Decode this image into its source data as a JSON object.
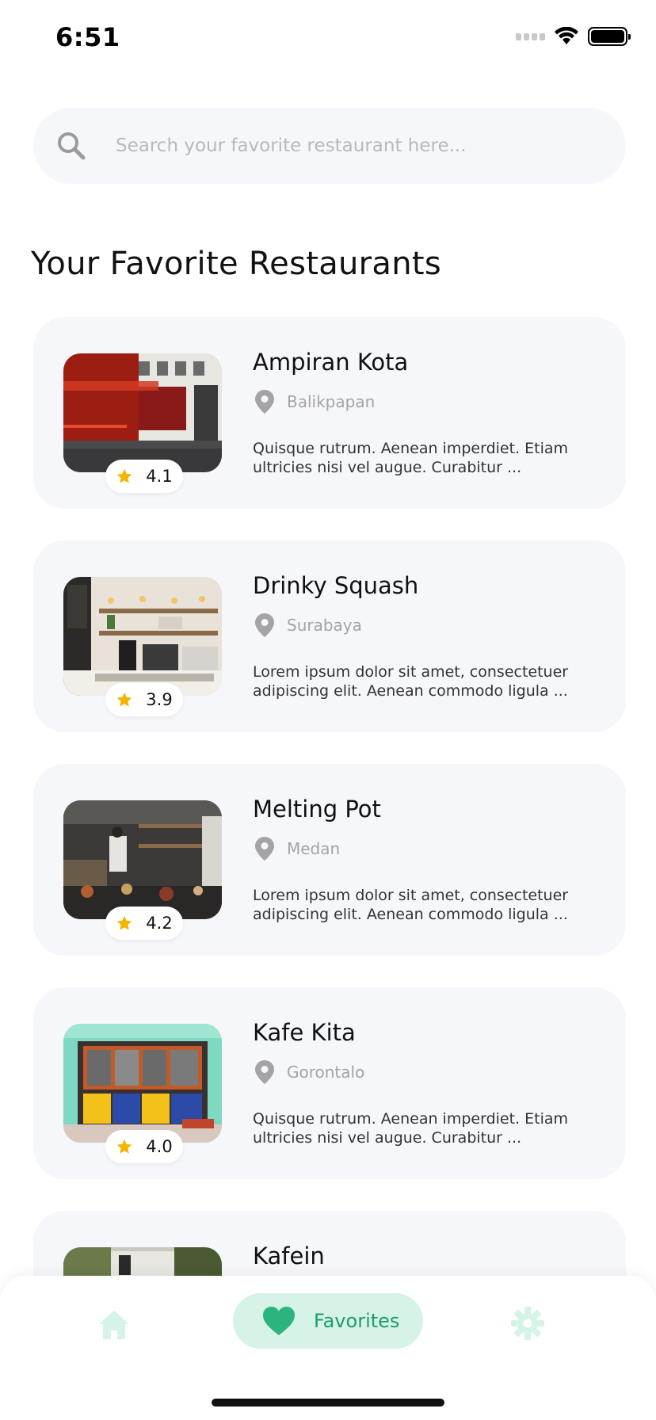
{
  "status_bar": {
    "time": "6:51"
  },
  "search": {
    "placeholder": "Search your favorite restaurant here..."
  },
  "page_title": "Your Favorite Restaurants",
  "colors": {
    "accent": "#2bb47d",
    "accent_soft": "#d5f3e6",
    "star": "#f5b400",
    "card_bg": "#f6f7fb"
  },
  "restaurants": [
    {
      "name": "Ampiran Kota",
      "city": "Balikpapan",
      "rating": "4.1",
      "description": "Quisque rutrum. Aenean imperdiet. Etiam ultricies nisi vel augue. Curabitur ..."
    },
    {
      "name": "Drinky Squash",
      "city": "Surabaya",
      "rating": "3.9",
      "description": "Lorem ipsum dolor sit amet, consectetuer adipiscing elit. Aenean commodo ligula ..."
    },
    {
      "name": "Melting Pot",
      "city": "Medan",
      "rating": "4.2",
      "description": "Lorem ipsum dolor sit amet, consectetuer adipiscing elit. Aenean commodo ligula ..."
    },
    {
      "name": "Kafe Kita",
      "city": "Gorontalo",
      "rating": "4.0",
      "description": "Quisque rutrum. Aenean imperdiet. Etiam ultricies nisi vel augue. Curabitur ..."
    },
    {
      "name": "Kafein",
      "city": "",
      "rating": "",
      "description": ""
    }
  ],
  "bottom_nav": {
    "home_icon": "home-icon",
    "favorites_label": "Favorites",
    "settings_icon": "settings-icon"
  }
}
